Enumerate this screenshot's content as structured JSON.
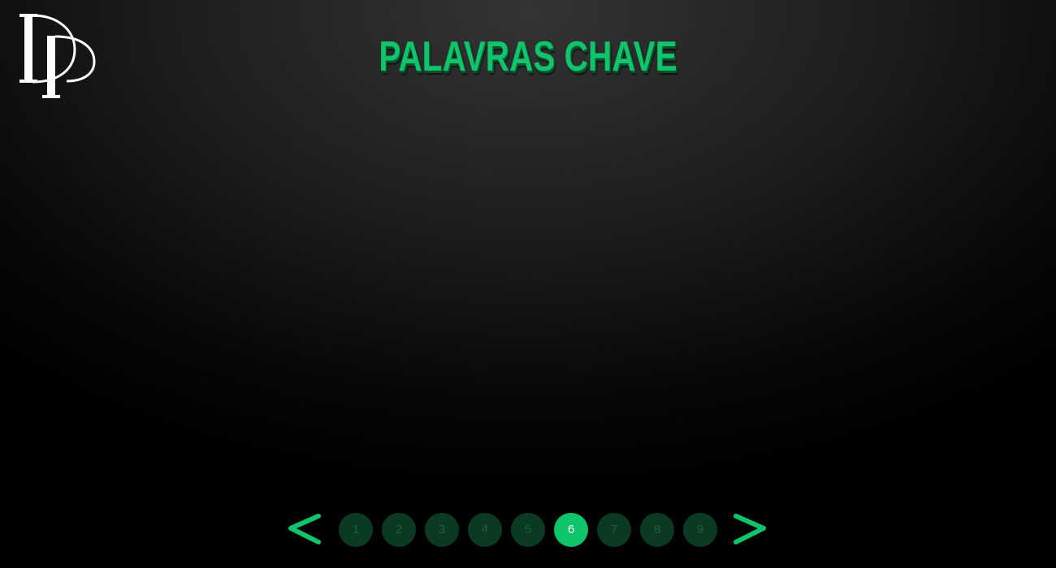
{
  "logo": {
    "icon": "dp-monogram-logo",
    "color": "#ffffff"
  },
  "header": {
    "title": "PALAVRAS CHAVE"
  },
  "pagination": {
    "prev_icon": "chevron-left-icon",
    "next_icon": "chevron-right-icon",
    "pages": [
      "1",
      "2",
      "3",
      "4",
      "5",
      "6",
      "7",
      "8",
      "9"
    ],
    "current_page": "6"
  },
  "colors": {
    "accent": "#0fc46a",
    "inactive_dot": "#0b3a22",
    "inactive_dot_text": "#1f5e3d",
    "background": "#1a1a1a"
  }
}
